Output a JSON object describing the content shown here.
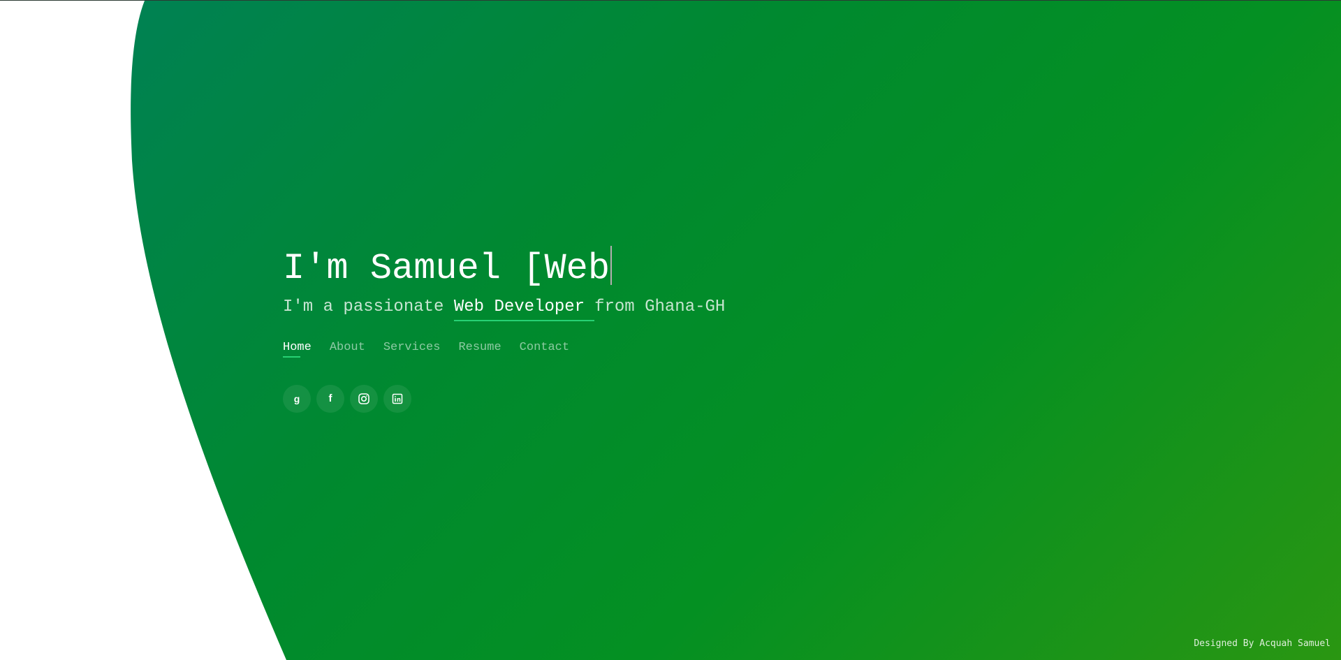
{
  "hero": {
    "headline": "I'm Samuel [Web",
    "tagline_prefix": "I'm a passionate",
    "tagline_role": "Web Developer",
    "tagline_suffix": "from Ghana-GH"
  },
  "nav": {
    "items": [
      {
        "label": "Home",
        "active": true
      },
      {
        "label": "About",
        "active": false
      },
      {
        "label": "Services",
        "active": false
      },
      {
        "label": "Resume",
        "active": false
      },
      {
        "label": "Contact",
        "active": false
      }
    ]
  },
  "socials": [
    {
      "icon": "google-plus-icon",
      "glyph": "g"
    },
    {
      "icon": "facebook-icon",
      "glyph": "f"
    },
    {
      "icon": "instagram-icon",
      "glyph": ""
    },
    {
      "icon": "linkedin-icon",
      "glyph": ""
    }
  ],
  "footer": {
    "credit": "Designed By Acquah Samuel"
  },
  "colors": {
    "gradient_start": "#00805a",
    "gradient_end": "#2a9612",
    "accent": "#27d174",
    "background": "#ffffff"
  }
}
